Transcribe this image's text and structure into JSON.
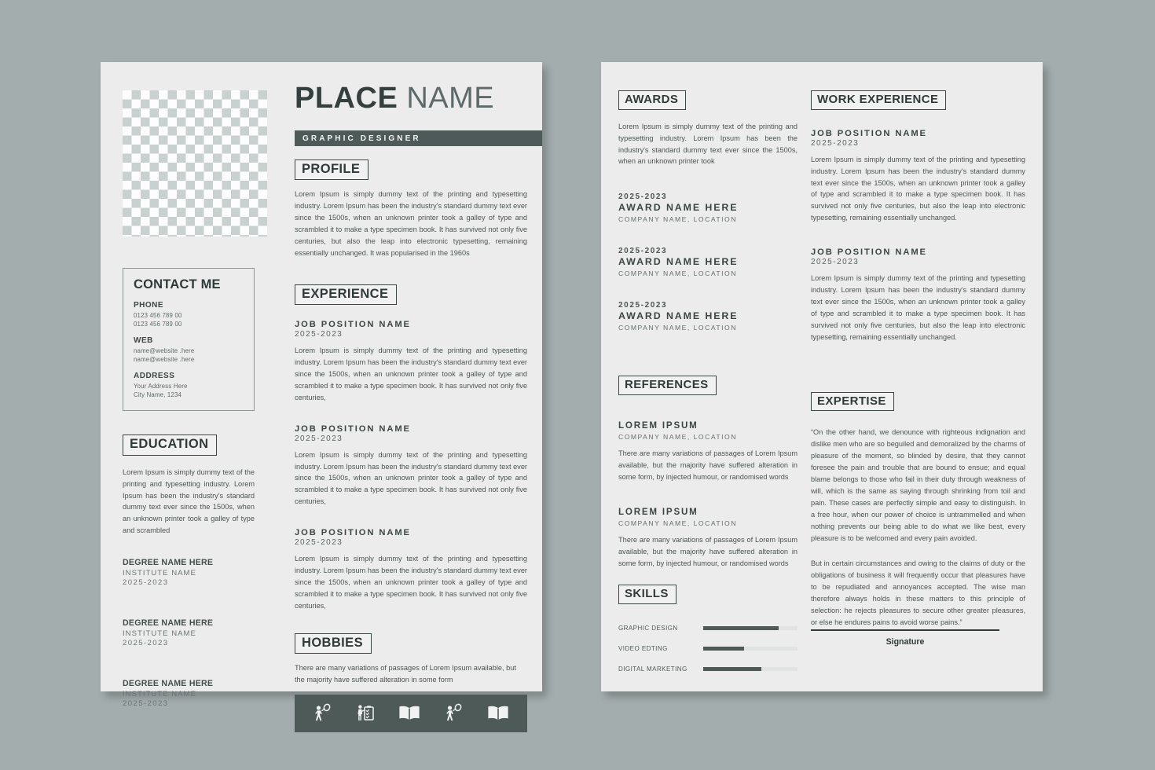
{
  "theme": {
    "background": "#a3adad",
    "paper": "#ececec",
    "accent_dark": "#4e5a58",
    "text_dark": "#2f3a39",
    "text_body": "#4b5453"
  },
  "page1": {
    "header": {
      "name_first": "PLACE",
      "name_last": "NAME",
      "role": "GRAPHIC DESIGNER",
      "photo_alt": "photo-placeholder"
    },
    "profile": {
      "heading": "PROFILE",
      "text": "Lorem Ipsum is simply dummy text of the printing and typesetting industry. Lorem Ipsum has been the industry's standard dummy text ever since the 1500s, when an unknown printer took a galley of type and scrambled it to make a type specimen book. It has survived not only five centuries, but also the leap into electronic typesetting, remaining essentially unchanged. It was popularised in the 1960s"
    },
    "contact": {
      "heading": "CONTACT ME",
      "groups": [
        {
          "label": "PHONE",
          "line1": "0123 456 789 00",
          "line2": "0123 456 789 00"
        },
        {
          "label": "WEB",
          "line1": "name@website .here",
          "line2": "name@website .here"
        },
        {
          "label": "ADDRESS",
          "line1": "Your Address Here",
          "line2": "City Name, 1234"
        }
      ]
    },
    "education": {
      "heading": "EDUCATION",
      "intro": "Lorem Ipsum is simply dummy text of the printing and typesetting industry. Lorem Ipsum has been the industry's standard dummy text ever since the 1500s, when an unknown printer took a galley of type and scrambled",
      "items": [
        {
          "degree": "DEGREE NAME HERE",
          "institute": "INSTITUTE NAME",
          "year": "2025-2023"
        },
        {
          "degree": "DEGREE NAME HERE",
          "institute": "INSTITUTE NAME",
          "year": "2025-2023"
        },
        {
          "degree": "DEGREE NAME HERE",
          "institute": "INSTITUTE NAME",
          "year": "2025-2023"
        }
      ]
    },
    "experience": {
      "heading": "EXPERIENCE",
      "items": [
        {
          "title": "JOB POSITION NAME",
          "year": "2025-2023",
          "text": "Lorem Ipsum is simply dummy text of the printing and typesetting industry. Lorem Ipsum has been the industry's standard dummy text ever since the 1500s, when an unknown printer took a galley of type and scrambled it to make a type specimen book. It has survived not only five centuries,"
        },
        {
          "title": "JOB POSITION NAME",
          "year": "2025-2023",
          "text": "Lorem Ipsum is simply dummy text of the printing and typesetting industry. Lorem Ipsum has been the industry's standard dummy text ever since the 1500s, when an unknown printer took a galley of type and scrambled it to make a type specimen book. It has survived not only five centuries,"
        },
        {
          "title": "JOB POSITION NAME",
          "year": "2025-2023",
          "text": "Lorem Ipsum is simply dummy text of the printing and typesetting industry. Lorem Ipsum has been the industry's standard dummy text ever since the 1500s, when an unknown printer took a galley of type and scrambled it to make a type specimen book. It has survived not only five centuries,"
        }
      ]
    },
    "hobbies": {
      "heading": "HOBBIES",
      "text": "There are many variations of passages of Lorem Ipsum available, but the majority have suffered alteration in some form",
      "icons": [
        "tennis-player-icon",
        "person-checklist-icon",
        "open-book-icon",
        "tennis-player-icon",
        "open-book-icon"
      ]
    }
  },
  "page2": {
    "awards": {
      "heading": "AWARDS",
      "intro": "Lorem Ipsum is simply dummy text of the printing and typesetting industry. Lorem Ipsum has been the industry's standard dummy text ever since the 1500s, when an unknown printer took",
      "items": [
        {
          "year": "2025-2023",
          "name": "AWARD NAME HERE",
          "company": "COMPANY NAME, LOCATION"
        },
        {
          "year": "2025-2023",
          "name": "AWARD NAME HERE",
          "company": "COMPANY NAME, LOCATION"
        },
        {
          "year": "2025-2023",
          "name": "AWARD NAME HERE",
          "company": "COMPANY NAME, LOCATION"
        }
      ]
    },
    "work_experience": {
      "heading": "WORK EXPERIENCE",
      "items": [
        {
          "title": "JOB POSITION NAME",
          "year": "2025-2023",
          "text": "Lorem Ipsum is simply dummy text of the printing and typesetting industry. Lorem Ipsum has been the industry's standard dummy text ever since the 1500s, when an unknown printer took a galley of type and scrambled it to make a type specimen book. It has survived not only five centuries, but also the leap into electronic typesetting, remaining essentially unchanged."
        },
        {
          "title": "JOB POSITION NAME",
          "year": "2025-2023",
          "text": "Lorem Ipsum is simply dummy text of the printing and typesetting industry. Lorem Ipsum has been the industry's standard dummy text ever since the 1500s, when an unknown printer took a galley of type and scrambled it to make a type specimen book. It has survived not only five centuries, but also the leap into electronic typesetting, remaining essentially unchanged."
        }
      ]
    },
    "references": {
      "heading": "REFERENCES",
      "items": [
        {
          "name": "LOREM IPSUM",
          "company": "COMPANY NAME, LOCATION",
          "text": "There are many variations of passages of Lorem Ipsum available, but the majority have suffered alteration in some form, by injected humour, or randomised words"
        },
        {
          "name": "LOREM IPSUM",
          "company": "COMPANY NAME, LOCATION",
          "text": "There are many variations of passages of Lorem Ipsum available, but the majority have suffered alteration in some form, by injected humour, or randomised words"
        }
      ]
    },
    "expertise": {
      "heading": "EXPERTISE",
      "paragraph1": "“On the other hand, we denounce with righteous indignation and dislike men who are so beguiled and demoralized by the charms of pleasure of the moment, so blinded by desire, that they cannot foresee the pain and trouble that are bound to ensue; and equal blame belongs to those who fail in their duty through weakness of will, which is the same as saying through shrinking from toil and pain. These cases are perfectly simple and easy to distinguish. In a free hour, when our power of choice is untrammelled and when nothing prevents our being able to do what we like best, every pleasure is to be welcomed and every pain avoided.",
      "paragraph2": "But in certain circumstances and owing to the claims of duty or the obligations of business it will frequently occur that pleasures have to be repudiated and annoyances accepted. The wise man therefore always holds in these matters to this principle of selection: he rejects pleasures to secure other greater pleasures, or else he endures pains to avoid worse pains.”"
    },
    "skills": {
      "heading": "SKILLS",
      "items": [
        {
          "label": "GRAPHIC DESIGN",
          "percent": 80
        },
        {
          "label": "VIDEO EDTING",
          "percent": 43
        },
        {
          "label": "DIGITAL MARKETING",
          "percent": 62
        }
      ]
    },
    "signature": {
      "label": "Signature"
    }
  }
}
